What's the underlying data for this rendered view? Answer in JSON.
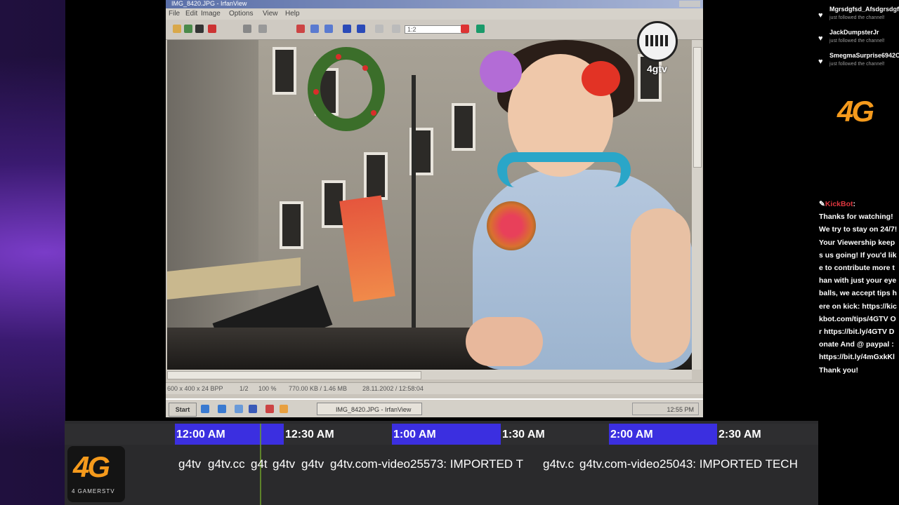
{
  "window": {
    "title": "IMG_8420.JPG - IrfanView",
    "menu": [
      "File",
      "Edit",
      "Image",
      "Options",
      "View",
      "Help"
    ],
    "toolbar_zoom_value": "1:2",
    "status": [
      "600 x 400 x 24 BPP",
      "1/2",
      "100 %",
      "770.00 KB / 1.46 MB",
      "28.11.2002 / 12:58:04"
    ],
    "taskbar": {
      "start_label": "Start",
      "task_label": "IMG_8420.JPG - IrfanView",
      "clock": "12:55 PM"
    }
  },
  "watermark": {
    "label": "4gtv"
  },
  "followers": [
    {
      "name": "Mgrsdgfsd_Afsdgrsdgf",
      "status": "just followed the channel!"
    },
    {
      "name": "JackDumpsterJr",
      "status": "just followed the channel!"
    },
    {
      "name": "SmegmaSurprise6942C",
      "status": "just followed the channel!"
    }
  ],
  "brand": {
    "logo_text": "4G",
    "logo_sub": "4 GAMERSTV"
  },
  "chat": {
    "author": "KickBot",
    "message": "Thanks for watching! We try to stay on 24/7! Your Viewership keeps us going! If you'd like to contribute more than with just your eyeballs, we accept tips here on kick: https://kickbot.com/tips/4GTV Or https://bit.ly/4GTV Donate And @ paypal : https://bit.ly/4mGxkKl Thank you!"
  },
  "schedule": {
    "slots": [
      "12:00 AM",
      "12:30 AM",
      "1:00 AM",
      "1:30 AM",
      "2:00 AM",
      "2:30 AM"
    ],
    "programs": [
      "g4tv",
      "g4tv.cc",
      "g4t",
      "g4tv",
      "g4tv",
      "g4tv.com-video25573: IMPORTED T",
      "g4tv.c",
      "g4tv.com-video25043: IMPORTED TECH"
    ]
  },
  "colors": {
    "accent_orange": "#f59a1c",
    "slot_highlight": "#3b2fe0",
    "chat_bot": "#e0373f"
  }
}
